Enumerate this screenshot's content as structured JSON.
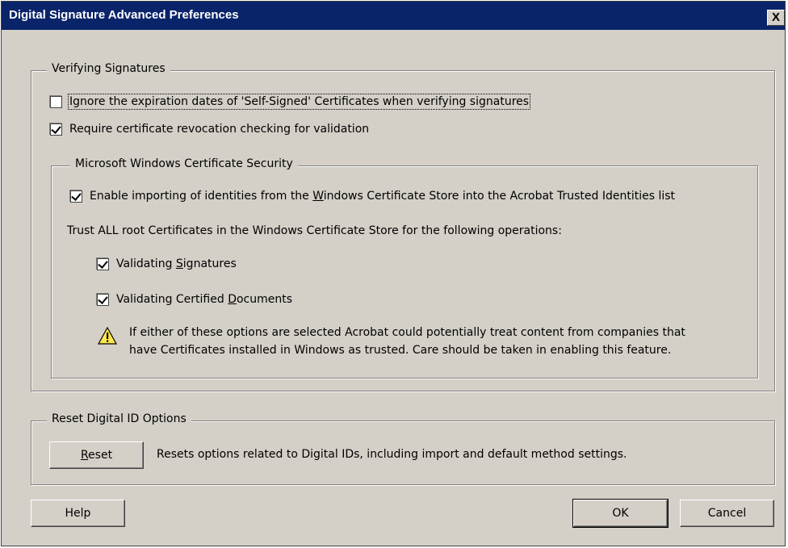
{
  "dialog": {
    "title": "Digital Signature Advanced Preferences",
    "close_label": "X"
  },
  "verifying": {
    "legend": "Verifying Signatures",
    "ignore_expiration": {
      "label": "Ignore the expiration dates of 'Self-Signed' Certificates when verifying signatures",
      "checked": false
    },
    "require_revocation": {
      "label": "Require certificate revocation checking for validation",
      "checked": true
    }
  },
  "windows_security": {
    "legend": "Microsoft Windows Certificate Security",
    "enable_import": {
      "label_pre": "Enable importing of identities from the ",
      "label_underlined": "W",
      "label_post": "indows Certificate Store into the Acrobat Trusted Identities list",
      "checked": true
    },
    "trust_text": "Trust ALL root Certificates in the Windows Certificate Store for the following operations:",
    "validating_signatures": {
      "label_pre": "Validating ",
      "label_underlined": "S",
      "label_post": "ignatures",
      "checked": true
    },
    "validating_documents": {
      "label_pre": "Validating Certified ",
      "label_underlined": "D",
      "label_post": "ocuments",
      "checked": true
    },
    "warning_line1": "If either of these options are selected Acrobat could potentially treat content from companies that",
    "warning_line2": "have Certificates installed in Windows as trusted. Care should be taken in enabling this feature.",
    "warning_icon": "warning-triangle-icon"
  },
  "reset": {
    "legend": "Reset Digital ID Options",
    "button_underlined": "R",
    "button_rest": "eset",
    "description": "Resets options related to Digital IDs, including import and default method settings."
  },
  "footer": {
    "help_label": "Help",
    "ok_label": "OK",
    "cancel_label": "Cancel"
  }
}
